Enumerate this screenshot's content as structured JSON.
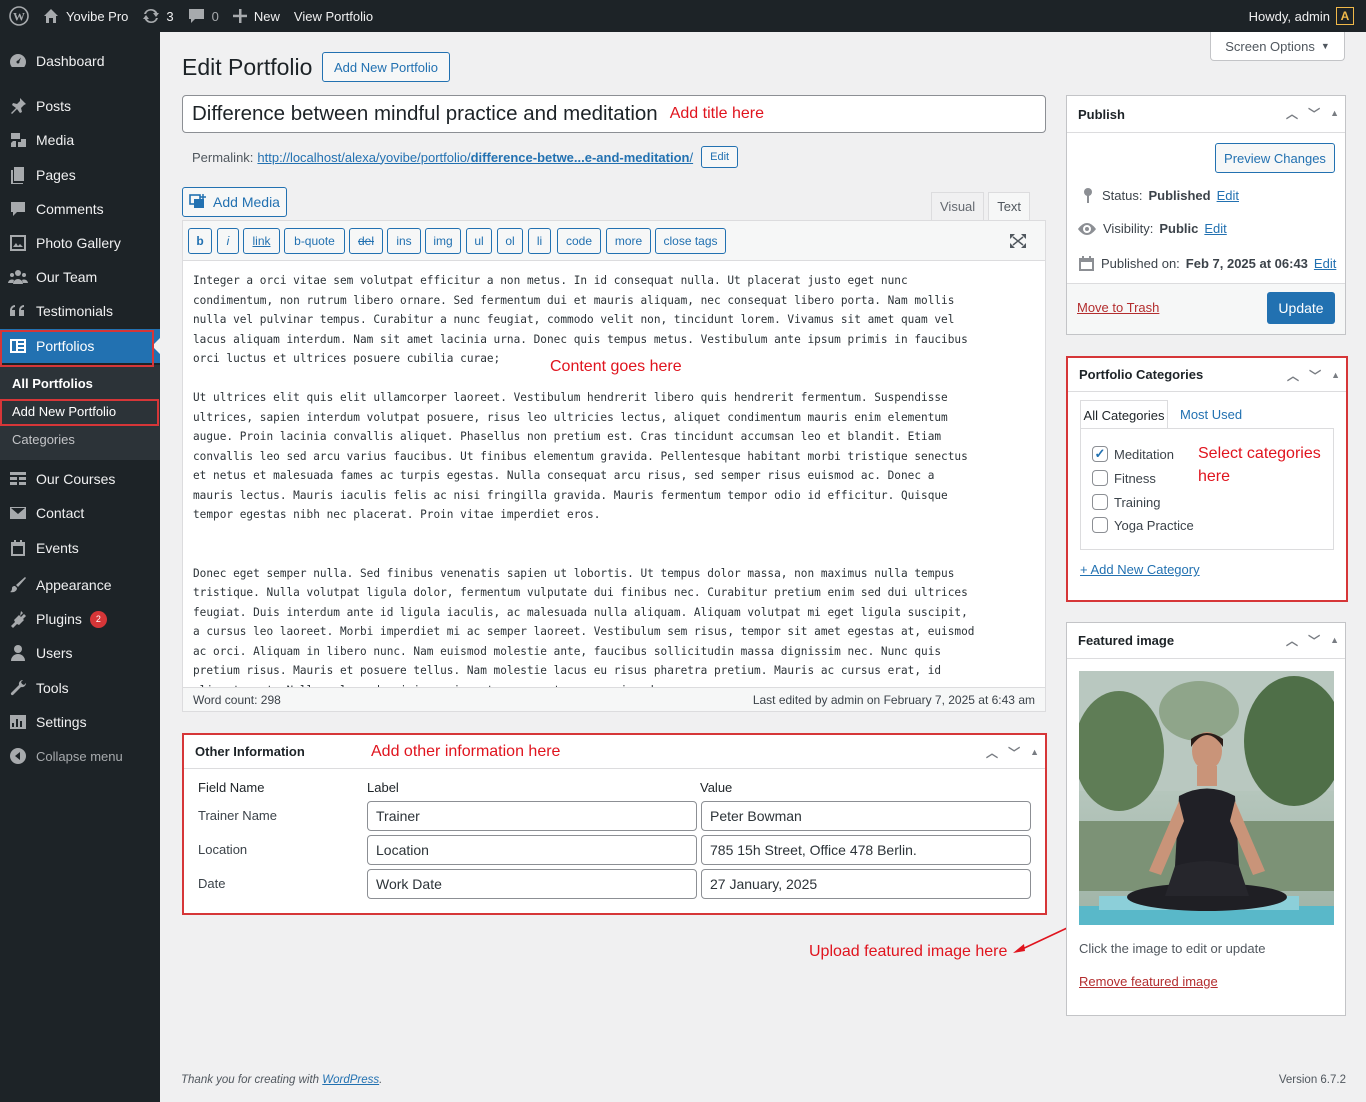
{
  "admin_bar": {
    "site_name": "Yovibe Pro",
    "updates_count": "3",
    "comments_count": "0",
    "new_label": "New",
    "view_label": "View Portfolio",
    "howdy": "Howdy, admin",
    "avatar_letter": "A"
  },
  "sidebar": {
    "items": [
      {
        "label": "Dashboard",
        "icon": "dashboard-icon"
      },
      {
        "label": "Posts",
        "icon": "pin-icon"
      },
      {
        "label": "Media",
        "icon": "media-icon"
      },
      {
        "label": "Pages",
        "icon": "page-icon"
      },
      {
        "label": "Comments",
        "icon": "comment-icon"
      },
      {
        "label": "Photo Gallery",
        "icon": "gallery-icon"
      },
      {
        "label": "Our Team",
        "icon": "team-icon"
      },
      {
        "label": "Testimonials",
        "icon": "quote-icon"
      },
      {
        "label": "Portfolios",
        "icon": "portfolio-icon"
      },
      {
        "label": "Our Courses",
        "icon": "courses-icon"
      },
      {
        "label": "Contact",
        "icon": "mail-icon"
      },
      {
        "label": "Events",
        "icon": "calendar-icon"
      },
      {
        "label": "Appearance",
        "icon": "brush-icon"
      },
      {
        "label": "Plugins",
        "icon": "plugin-icon"
      },
      {
        "label": "Users",
        "icon": "user-icon"
      },
      {
        "label": "Tools",
        "icon": "wrench-icon"
      },
      {
        "label": "Settings",
        "icon": "settings-icon"
      }
    ],
    "plugins_badge": "2",
    "submenu": [
      "All Portfolios",
      "Add New Portfolio",
      "Categories"
    ],
    "collapse_label": "Collapse menu"
  },
  "screen_options": "Screen Options",
  "page": {
    "heading": "Edit Portfolio",
    "add_new_button": "Add New Portfolio",
    "title_value": "Difference between mindful practice and meditation",
    "title_annotation": "Add title here",
    "permalink_label": "Permalink:",
    "permalink_base": "http://localhost/alexa/yovibe/portfolio/",
    "permalink_slug": "difference-betwe...e-and-meditation",
    "permalink_trailing": "/",
    "permalink_edit": "Edit"
  },
  "editor": {
    "add_media": "Add Media",
    "tab_visual": "Visual",
    "tab_text": "Text",
    "quicktags": [
      "b",
      "i",
      "link",
      "b-quote",
      "del",
      "ins",
      "img",
      "ul",
      "ol",
      "li",
      "code",
      "more",
      "close tags"
    ],
    "content": "Integer a orci vitae sem volutpat efficitur a non metus. In id consequat nulla. Ut placerat justo eget nunc\ncondimentum, non rutrum libero ornare. Sed fermentum dui et mauris aliquam, nec consequat libero porta. Nam mollis\nnulla vel pulvinar tempus. Curabitur a nunc feugiat, commodo velit non, tincidunt lorem. Vivamus sit amet quam vel\nlacus aliquam interdum. Nam sit amet lacinia urna. Donec quis tempus metus. Vestibulum ante ipsum primis in faucibus\norci luctus et ultrices posuere cubilia curae;\n\nUt ultrices elit quis elit ullamcorper laoreet. Vestibulum hendrerit libero quis hendrerit fermentum. Suspendisse\nultrices, sapien interdum volutpat posuere, risus leo ultricies lectus, aliquet condimentum mauris enim elementum\naugue. Proin lacinia convallis aliquet. Phasellus non pretium est. Cras tincidunt accumsan leo et blandit. Etiam\nconvallis leo sed arcu varius faucibus. Ut finibus elementum gravida. Pellentesque habitant morbi tristique senectus\net netus et malesuada fames ac turpis egestas. Nulla consequat arcu risus, sed semper risus euismod ac. Donec a\nmauris lectus. Mauris iaculis felis ac nisi fringilla gravida. Mauris fermentum tempor odio id efficitur. Quisque\ntempor egestas nibh nec placerat. Proin vitae imperdiet eros.\n\n\nDonec eget semper nulla. Sed finibus venenatis sapien ut lobortis. Ut tempus dolor massa, non maximus nulla tempus\ntristique. Nulla volutpat ligula dolor, fermentum vulputate dui finibus nec. Curabitur pretium enim sed dui ultrices\nfeugiat. Duis interdum ante id ligula iaculis, ac malesuada nulla aliquam. Aliquam volutpat mi eget ligula suscipit,\na cursus leo laoreet. Morbi imperdiet mi ac semper laoreet. Vestibulum sem risus, tempor sit amet egestas at, euismod\nac orci. Aliquam in libero nunc. Nam euismod molestie ante, faucibus sollicitudin massa dignissim nec. Nunc quis\npretium risus. Mauris et posuere tellus. Nam molestie lacus eu risus pharetra pretium. Mauris ac cursus erat, id\naliquet erat. Nulla malesuada nisi mauris, ut consequat massa euismod non.",
    "content_annotation": "Content goes here",
    "word_count": "Word count: 298",
    "last_edited": "Last edited by admin on February 7, 2025 at 6:43 am"
  },
  "other_info": {
    "title": "Other Information",
    "annotation": "Add other information here",
    "col_field": "Field Name",
    "col_label": "Label",
    "col_value": "Value",
    "rows": [
      {
        "field": "Trainer Name",
        "label": "Trainer",
        "value": "Peter Bowman"
      },
      {
        "field": "Location",
        "label": "Location",
        "value": "785 15h Street, Office 478 Berlin."
      },
      {
        "field": "Date",
        "label": "Work Date",
        "value": "27 January, 2025"
      }
    ]
  },
  "publish": {
    "title": "Publish",
    "preview": "Preview Changes",
    "status_label": "Status:",
    "status_value": "Published",
    "visibility_label": "Visibility:",
    "visibility_value": "Public",
    "published_label": "Published on:",
    "published_value": "Feb 7, 2025 at 06:43",
    "edit": "Edit",
    "trash": "Move to Trash",
    "update": "Update"
  },
  "categories": {
    "title": "Portfolio Categories",
    "tab_all": "All Categories",
    "tab_most": "Most Used",
    "items": [
      {
        "name": "Meditation",
        "checked": true
      },
      {
        "name": "Fitness",
        "checked": false
      },
      {
        "name": "Training",
        "checked": false
      },
      {
        "name": "Yoga Practice",
        "checked": false
      }
    ],
    "annotation_line1": "Select categories",
    "annotation_line2": "here",
    "add_new": "+ Add New Category"
  },
  "featured": {
    "title": "Featured image",
    "hint": "Click the image to edit or update",
    "remove": "Remove featured image",
    "annotation": "Upload featured image here"
  },
  "footer": {
    "thanks_prefix": "Thank you for creating with ",
    "wordpress": "WordPress",
    "thanks_suffix": ".",
    "version": "Version 6.7.2"
  },
  "colors": {
    "accent": "#2271b1",
    "annotation_red": "#e0141e",
    "sidebar_bg": "#1d2327"
  }
}
